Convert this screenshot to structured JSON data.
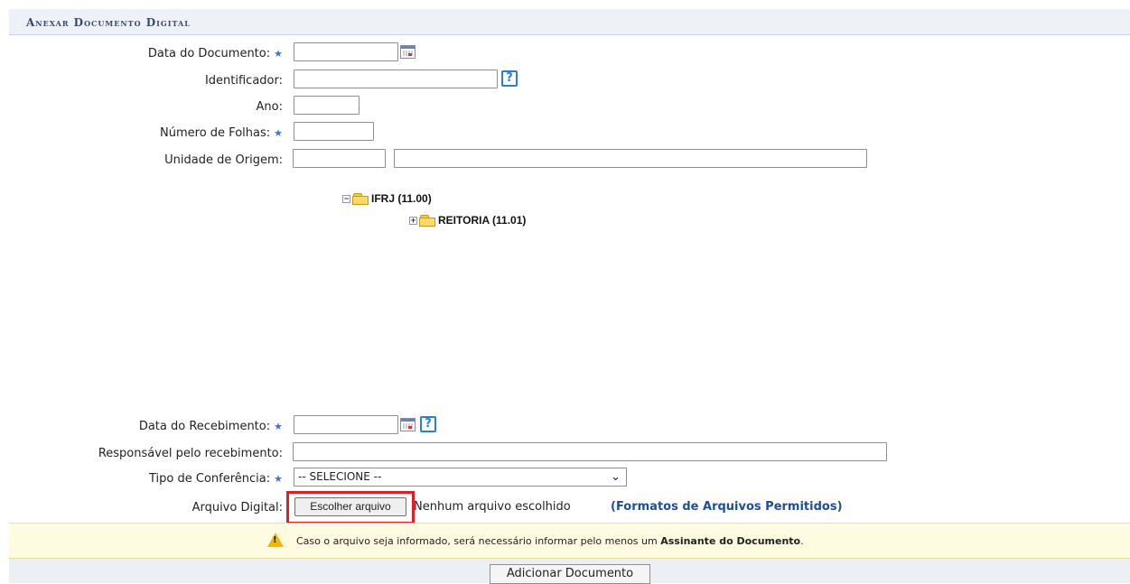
{
  "form": {
    "title": "Anexar Documento Digital",
    "fields": {
      "data_documento": {
        "label": "Data do Documento:",
        "required_mark": "★",
        "value": ""
      },
      "identificador": {
        "label": "Identificador:",
        "value": "",
        "help": "?"
      },
      "ano": {
        "label": "Ano:",
        "value": ""
      },
      "numero_folhas": {
        "label": "Número de Folhas:",
        "required_mark": "★",
        "value": ""
      },
      "unidade_origem": {
        "label": "Unidade de Origem:",
        "code_value": "",
        "name_value": ""
      },
      "data_recebimento": {
        "label": "Data do Recebimento:",
        "required_mark": "★",
        "value": "",
        "help": "?"
      },
      "responsavel": {
        "label": "Responsável pelo recebimento:",
        "value": ""
      },
      "tipo_conferencia": {
        "label": "Tipo de Conferência:",
        "required_mark": "★",
        "selected": "-- SELECIONE --"
      },
      "arquivo": {
        "label": "Arquivo Digital:",
        "button_label": "Escolher arquivo",
        "status": "Nenhum arquivo escolhido",
        "formats_link": "(Formatos de Arquivos Permitidos)"
      }
    },
    "tree": {
      "root": {
        "label": "IFRJ (11.00)",
        "toggle": "−"
      },
      "child": {
        "label": "REITORIA (11.01)",
        "toggle": "+"
      }
    },
    "notice": {
      "text_before": "Caso o arquivo seja informado, será necessário informar pelo menos um ",
      "text_bold": "Assinante do Documento",
      "text_after": ".",
      "icon": "!"
    },
    "submit_label": "Adicionar Documento"
  },
  "colors": {
    "highlight": "#e01e26",
    "required": "#3b73d9",
    "link": "#1f4e99",
    "notice_bg": "#fffbe0"
  }
}
